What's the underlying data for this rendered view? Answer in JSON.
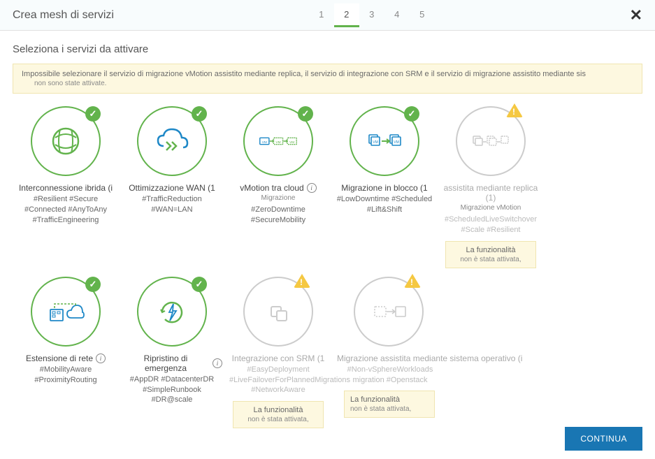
{
  "header": {
    "title": "Crea mesh di servizi",
    "steps": [
      "1",
      "2",
      "3",
      "4",
      "5"
    ],
    "activeStep": 1
  },
  "section_title": "Seleziona i servizi da attivare",
  "alert": {
    "main": "Impossibile selezionare il servizio di migrazione vMotion assistito mediante replica, il servizio di integrazione con SRM e il servizio di migrazione assistito mediante sis",
    "sub": "non sono state attivate."
  },
  "cards": [
    {
      "id": "interconnect",
      "title": "Interconnessione ibrida (i",
      "subtitle": "",
      "tags": "#Resilient #Secure #Connected #AnyToAny #TrafficEngineering",
      "state": "selected",
      "badge": "check",
      "hasInfo": false
    },
    {
      "id": "wan",
      "title": "Ottimizzazione WAN (1",
      "subtitle": "",
      "tags": "#TrafficReduction #WAN=LAN",
      "state": "selected",
      "badge": "check",
      "hasInfo": false
    },
    {
      "id": "vmotion",
      "title": "vMotion tra cloud",
      "subtitle": "Migrazione",
      "tags": "#ZeroDowntime #SecureMobility",
      "state": "selected",
      "badge": "check",
      "hasInfo": true
    },
    {
      "id": "bulk",
      "title": "Migrazione in blocco (1",
      "subtitle": "",
      "tags": "#LowDowntime #Scheduled #Lift&Shift",
      "state": "selected",
      "badge": "check",
      "hasInfo": false
    },
    {
      "id": "replica",
      "title": "assistita mediante replica (1)",
      "subtitle": "Migrazione vMotion",
      "tags": "#ScheduledLiveSwitchover #Scale #Resilient",
      "state": "disabled",
      "badge": "warn",
      "hasInfo": false,
      "warn": {
        "title": "La funzionalità",
        "sub": "non è stata attivata,"
      }
    },
    {
      "id": "netext",
      "title": "Estensione di rete",
      "subtitle": "",
      "tags": "#MobilityAware #ProximityRouting",
      "state": "selected",
      "badge": "check",
      "hasInfo": true
    },
    {
      "id": "dr",
      "title": "Ripristino di emergenza",
      "subtitle": "",
      "tags": "#AppDR #DatacenterDR #SimpleRunbook #DR@scale",
      "state": "selected",
      "badge": "check",
      "hasInfo": true
    },
    {
      "id": "srm",
      "title": "Integrazione con SRM (1",
      "subtitle": "",
      "tags": "#EasyDeployment #LiveFailoverForPlannedMigrations #NetworkAware",
      "state": "disabled",
      "badge": "warn",
      "hasInfo": false,
      "warn": {
        "title": "La funzionalità",
        "sub": "non è stata attivata,"
      }
    },
    {
      "id": "osassist",
      "title": "Migrazione assistita mediante sistema operativo (i",
      "subtitle": "",
      "tags": "#Non-vSphereWorkloads migration #Openstack",
      "state": "disabled",
      "badge": "warn",
      "hasInfo": false,
      "warn": {
        "title": "La funzionalità",
        "sub": "non è stata attivata,"
      }
    }
  ],
  "footer": {
    "continue": "CONTINUA"
  },
  "colors": {
    "green": "#62b34c",
    "blue": "#1976b3",
    "yellow": "#f5c842",
    "alertBg": "#fdf8e0"
  }
}
